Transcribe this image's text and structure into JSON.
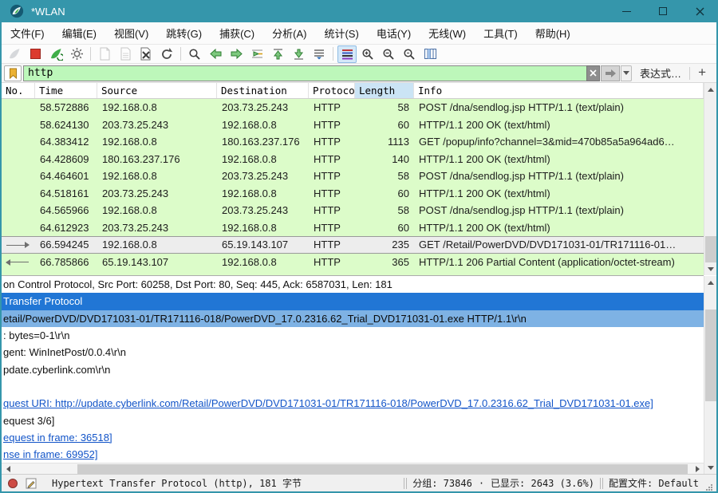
{
  "window": {
    "title": "*WLAN",
    "accent_color": "#3596ab"
  },
  "menu": {
    "items": [
      "文件(F)",
      "编辑(E)",
      "视图(V)",
      "跳转(G)",
      "捕获(C)",
      "分析(A)",
      "统计(S)",
      "电话(Y)",
      "无线(W)",
      "工具(T)",
      "帮助(H)"
    ]
  },
  "toolbar": {
    "icons": [
      "start-capture",
      "stop-capture",
      "restart-capture",
      "capture-options",
      "open-file",
      "save-file",
      "close-file",
      "reload-file",
      "find-packet",
      "go-back",
      "go-forward",
      "go-to-packet",
      "go-first",
      "go-last",
      "auto-scroll",
      "colorize-active",
      "zoom-in",
      "zoom-out",
      "zoom-original",
      "resize-columns"
    ]
  },
  "filter": {
    "value": "http",
    "expression_label": "表达式…",
    "add_label": "+"
  },
  "packet_list": {
    "columns": [
      "No.",
      "Time",
      "Source",
      "Destination",
      "Protocol",
      "Length",
      "Info"
    ],
    "sorted_column": "Length",
    "row_color": "#dcfcc9",
    "rows": [
      {
        "time": "58.572886",
        "source": "192.168.0.8",
        "destination": "203.73.25.243",
        "protocol": "HTTP",
        "length": "58",
        "info": "POST /dna/sendlog.jsp HTTP/1.1  (text/plain)"
      },
      {
        "time": "58.624130",
        "source": "203.73.25.243",
        "destination": "192.168.0.8",
        "protocol": "HTTP",
        "length": "60",
        "info": "HTTP/1.1 200 OK  (text/html)"
      },
      {
        "time": "64.383412",
        "source": "192.168.0.8",
        "destination": "180.163.237.176",
        "protocol": "HTTP",
        "length": "1113",
        "info": "GET /popup/info?channel=3&mid=470b85a5a964ad6…"
      },
      {
        "time": "64.428609",
        "source": "180.163.237.176",
        "destination": "192.168.0.8",
        "protocol": "HTTP",
        "length": "140",
        "info": "HTTP/1.1 200 OK  (text/html)"
      },
      {
        "time": "64.464601",
        "source": "192.168.0.8",
        "destination": "203.73.25.243",
        "protocol": "HTTP",
        "length": "58",
        "info": "POST /dna/sendlog.jsp HTTP/1.1  (text/plain)"
      },
      {
        "time": "64.518161",
        "source": "203.73.25.243",
        "destination": "192.168.0.8",
        "protocol": "HTTP",
        "length": "60",
        "info": "HTTP/1.1 200 OK  (text/html)"
      },
      {
        "time": "64.565966",
        "source": "192.168.0.8",
        "destination": "203.73.25.243",
        "protocol": "HTTP",
        "length": "58",
        "info": "POST /dna/sendlog.jsp HTTP/1.1  (text/plain)"
      },
      {
        "time": "64.612923",
        "source": "203.73.25.243",
        "destination": "192.168.0.8",
        "protocol": "HTTP",
        "length": "60",
        "info": "HTTP/1.1 200 OK  (text/html)"
      },
      {
        "time": "66.594245",
        "source": "192.168.0.8",
        "destination": "65.19.143.107",
        "protocol": "HTTP",
        "length": "235",
        "info": "GET /Retail/PowerDVD/DVD171031-01/TR171116-01…",
        "selected": true,
        "marker": "request"
      },
      {
        "time": "66.785866",
        "source": "65.19.143.107",
        "destination": "192.168.0.8",
        "protocol": "HTTP",
        "length": "365",
        "info": "HTTP/1.1 206 Partial Content  (application/octet-stream)",
        "marker": "response"
      }
    ]
  },
  "detail_pane": {
    "selection_color": "#2176d5",
    "child_selection_color": "#7eb2e4",
    "link_color": "#1254c8",
    "lines": [
      {
        "text": "on Control Protocol, Src Port: 60258, Dst Port: 80, Seq: 445, Ack: 6587031, Len: 181",
        "style": "plain"
      },
      {
        "text": "Transfer Protocol",
        "style": "selected"
      },
      {
        "text": "etail/PowerDVD/DVD171031-01/TR171116-018/PowerDVD_17.0.2316.62_Trial_DVD171031-01.exe HTTP/1.1\\r\\n",
        "style": "child"
      },
      {
        "text": ": bytes=0-1\\r\\n",
        "style": "plain"
      },
      {
        "text": "gent: WinInetPost/0.0.4\\r\\n",
        "style": "plain"
      },
      {
        "text": "pdate.cyberlink.com\\r\\n",
        "style": "plain"
      },
      {
        "text": "",
        "style": "plain"
      },
      {
        "text": "quest URI: http://update.cyberlink.com/Retail/PowerDVD/DVD171031-01/TR171116-018/PowerDVD_17.0.2316.62_Trial_DVD171031-01.exe]",
        "style": "link"
      },
      {
        "text": "equest 3/6]",
        "style": "plain"
      },
      {
        "text": "equest in frame: 36518]",
        "style": "link"
      },
      {
        "text": "nse in frame: 69952]",
        "style": "link"
      }
    ]
  },
  "status_bar": {
    "left_text": "Hypertext Transfer Protocol (http), 181 字节",
    "packets_label": "分组: 73846",
    "dot": "·",
    "displayed_label": "已显示: 2643 (3.6%)",
    "profile_label": "配置文件: Default"
  }
}
